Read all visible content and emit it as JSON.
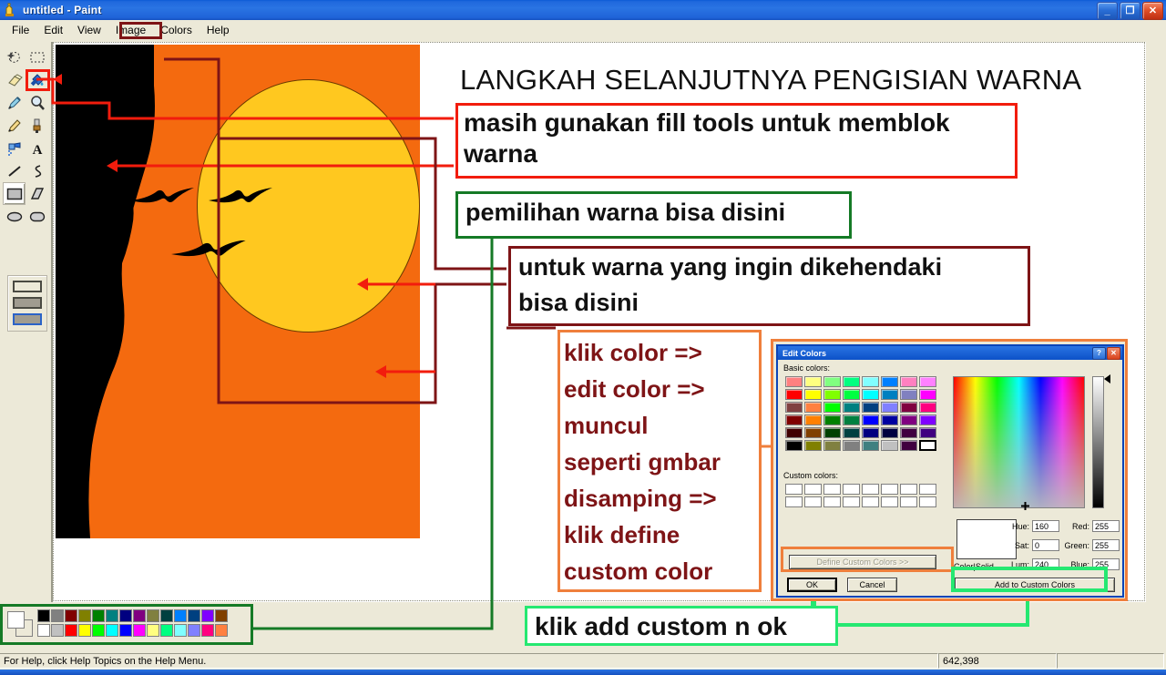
{
  "window": {
    "title": "untitled - Paint",
    "icon": "paint-app-icon",
    "minimize": "minimize-icon",
    "maximize": "maximize-icon",
    "close": "close-icon"
  },
  "menu": {
    "items": [
      {
        "label": "File"
      },
      {
        "label": "Edit"
      },
      {
        "label": "View"
      },
      {
        "label": "Image"
      },
      {
        "label": "Colors",
        "highlighted": true
      },
      {
        "label": "Help"
      }
    ]
  },
  "toolbox": {
    "tools": [
      {
        "name": "free-form-select-tool",
        "icon": "free-form-select-icon"
      },
      {
        "name": "rectangle-select-tool",
        "icon": "rectangle-select-icon"
      },
      {
        "name": "eraser-tool",
        "icon": "eraser-icon"
      },
      {
        "name": "fill-with-color-tool",
        "icon": "paint-bucket-icon",
        "highlighted": true
      },
      {
        "name": "pick-color-tool",
        "icon": "eyedropper-icon"
      },
      {
        "name": "magnifier-tool",
        "icon": "magnifier-icon"
      },
      {
        "name": "pencil-tool",
        "icon": "pencil-icon"
      },
      {
        "name": "brush-tool",
        "icon": "paintbrush-icon"
      },
      {
        "name": "airbrush-tool",
        "icon": "airbrush-icon"
      },
      {
        "name": "text-tool",
        "icon": "text-a-icon"
      },
      {
        "name": "line-tool",
        "icon": "line-icon"
      },
      {
        "name": "curve-tool",
        "icon": "curve-icon"
      },
      {
        "name": "rectangle-tool",
        "icon": "rectangle-icon",
        "selected": true
      },
      {
        "name": "polygon-tool",
        "icon": "polygon-icon"
      },
      {
        "name": "ellipse-tool",
        "icon": "ellipse-icon"
      },
      {
        "name": "rounded-rectangle-tool",
        "icon": "rounded-rectangle-icon"
      }
    ],
    "fill_styles": [
      "outline-only",
      "outline-and-fill",
      "fill-only-selected"
    ]
  },
  "canvas": {
    "artwork_description": "rock climber silhouette against orange sunset sky with yellow sun and birds"
  },
  "annotations": {
    "title": "LANGKAH SELANJUTNYA PENGISIAN WARNA",
    "red_box": [
      "masih gunakan fill tools untuk memblok",
      "warna"
    ],
    "green_box": [
      "pemilihan warna bisa disini"
    ],
    "brown_box": [
      "untuk warna yang ingin dikehendaki",
      "bisa disini"
    ],
    "orange_box": [
      "klik color =>",
      "edit color =>",
      "muncul",
      "seperti gmbar",
      "disamping =>",
      "klik define",
      "custom color"
    ],
    "lime_box": [
      "klik add custom n ok"
    ],
    "colors": {
      "red": "#f21c0d",
      "green": "#157a26",
      "brown": "#7e1416",
      "orange": "#ef7f3c",
      "lime": "#25e871"
    }
  },
  "dialog": {
    "title": "Edit Colors",
    "help_button": "?",
    "close_button": "close-icon",
    "basic_colors_label": "Basic colors:",
    "custom_colors_label": "Custom colors:",
    "define_custom_colors_label": "Define Custom Colors >>",
    "ok_label": "OK",
    "cancel_label": "Cancel",
    "add_to_custom_colors_label": "Add to Custom Colors",
    "color_solid_label": "Color|Solid",
    "fields": [
      {
        "label": "Hue:",
        "value": "160"
      },
      {
        "label": "Sat:",
        "value": "0"
      },
      {
        "label": "Lum:",
        "value": "240"
      },
      {
        "label": "Red:",
        "value": "255"
      },
      {
        "label": "Green:",
        "value": "255"
      },
      {
        "label": "Blue:",
        "value": "255"
      }
    ],
    "basic_colors": [
      "#ff8080",
      "#ffff80",
      "#80ff80",
      "#00ff80",
      "#80ffff",
      "#0080ff",
      "#ff80c0",
      "#ff80ff",
      "#ff0000",
      "#ffff00",
      "#80ff00",
      "#00ff40",
      "#00ffff",
      "#0080c0",
      "#8080c0",
      "#ff00ff",
      "#804040",
      "#ff8040",
      "#00ff00",
      "#008080",
      "#004080",
      "#8080ff",
      "#800040",
      "#ff0080",
      "#800000",
      "#ff8000",
      "#008000",
      "#008040",
      "#0000ff",
      "#0000a0",
      "#800080",
      "#8000ff",
      "#400000",
      "#804000",
      "#004000",
      "#004040",
      "#000080",
      "#000040",
      "#400040",
      "#400080",
      "#000000",
      "#808000",
      "#808040",
      "#808080",
      "#408080",
      "#c0c0c0",
      "#400040",
      "#ffffff"
    ],
    "selected_basic_color": "#ffffff",
    "custom_colors_count": 16
  },
  "palette": {
    "current_foreground": "#ffffff",
    "current_background": "#ece9d8",
    "row_top": [
      "#000000",
      "#808080",
      "#800000",
      "#808000",
      "#008000",
      "#008080",
      "#000080",
      "#800080",
      "#808040",
      "#004040",
      "#0080ff",
      "#004080",
      "#8000ff",
      "#804000"
    ],
    "row_bottom": [
      "#ffffff",
      "#c0c0c0",
      "#ff0000",
      "#ffff00",
      "#00ff00",
      "#00ffff",
      "#0000ff",
      "#ff00ff",
      "#ffff80",
      "#00ff80",
      "#80ffff",
      "#8080ff",
      "#ff0080",
      "#ff8040"
    ]
  },
  "statusbar": {
    "help_text": "For Help, click Help Topics on the Help Menu.",
    "coordinates": "642,398",
    "selection_size": ""
  }
}
